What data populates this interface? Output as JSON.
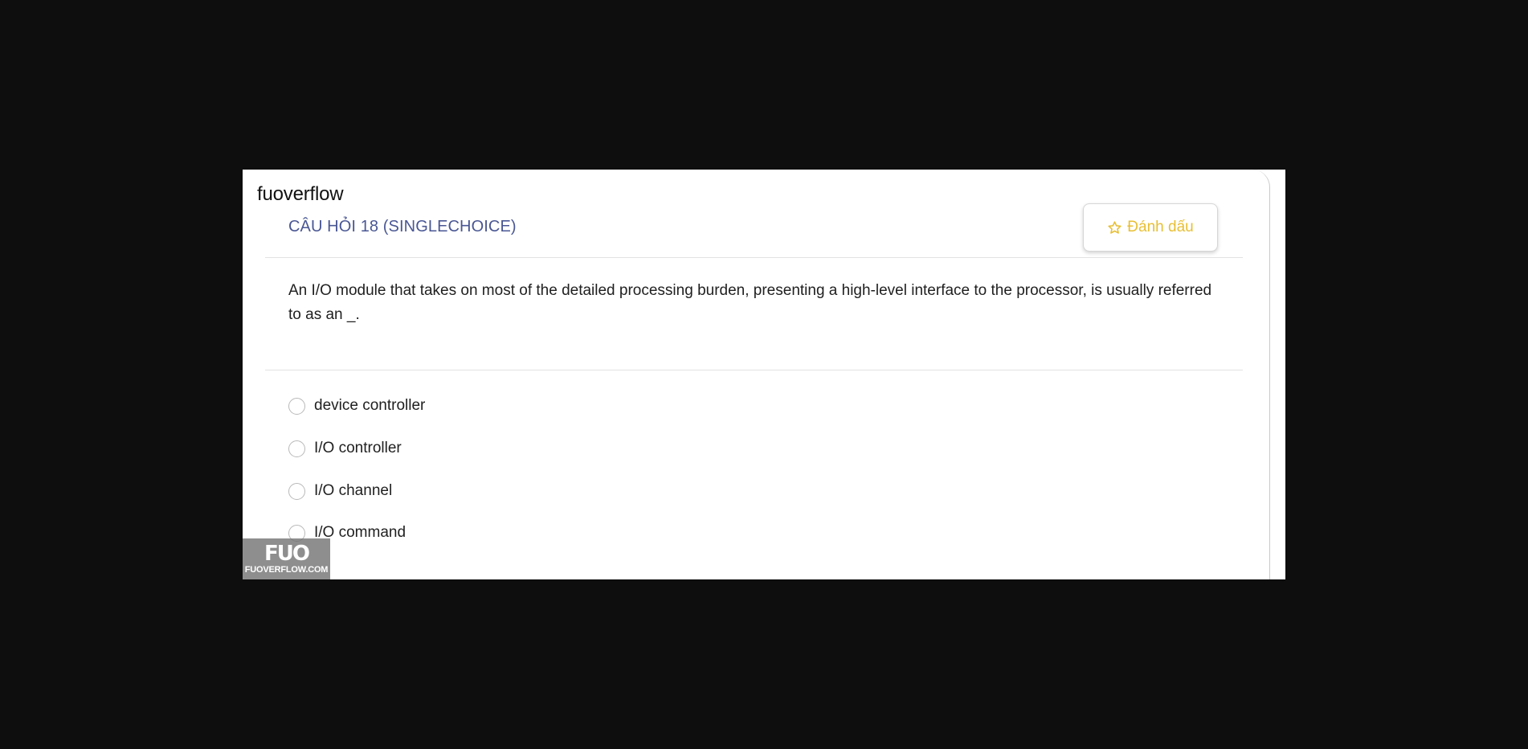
{
  "brand": "fuoverflow",
  "question": {
    "title": "CÂU HỎI 18 (SINGLECHOICE)",
    "text": "An I/O module that takes on most of the detailed processing burden, presenting a high-level interface to the processor, is usually referred to as an _.",
    "options": [
      {
        "label": "device controller",
        "selected": false
      },
      {
        "label": "I/O controller",
        "selected": false
      },
      {
        "label": "I/O channel",
        "selected": false
      },
      {
        "label": "I/O command",
        "selected": false
      }
    ]
  },
  "mark_button": {
    "label": "Đánh dấu",
    "icon": "star-outline-icon"
  },
  "watermark": {
    "logo": "FUO",
    "site": "FUOVERFLOW.COM"
  },
  "colors": {
    "background": "#0e0e0e",
    "title": "#4a5794",
    "mark_accent": "#e8bf33",
    "text": "#1f1f1f"
  }
}
